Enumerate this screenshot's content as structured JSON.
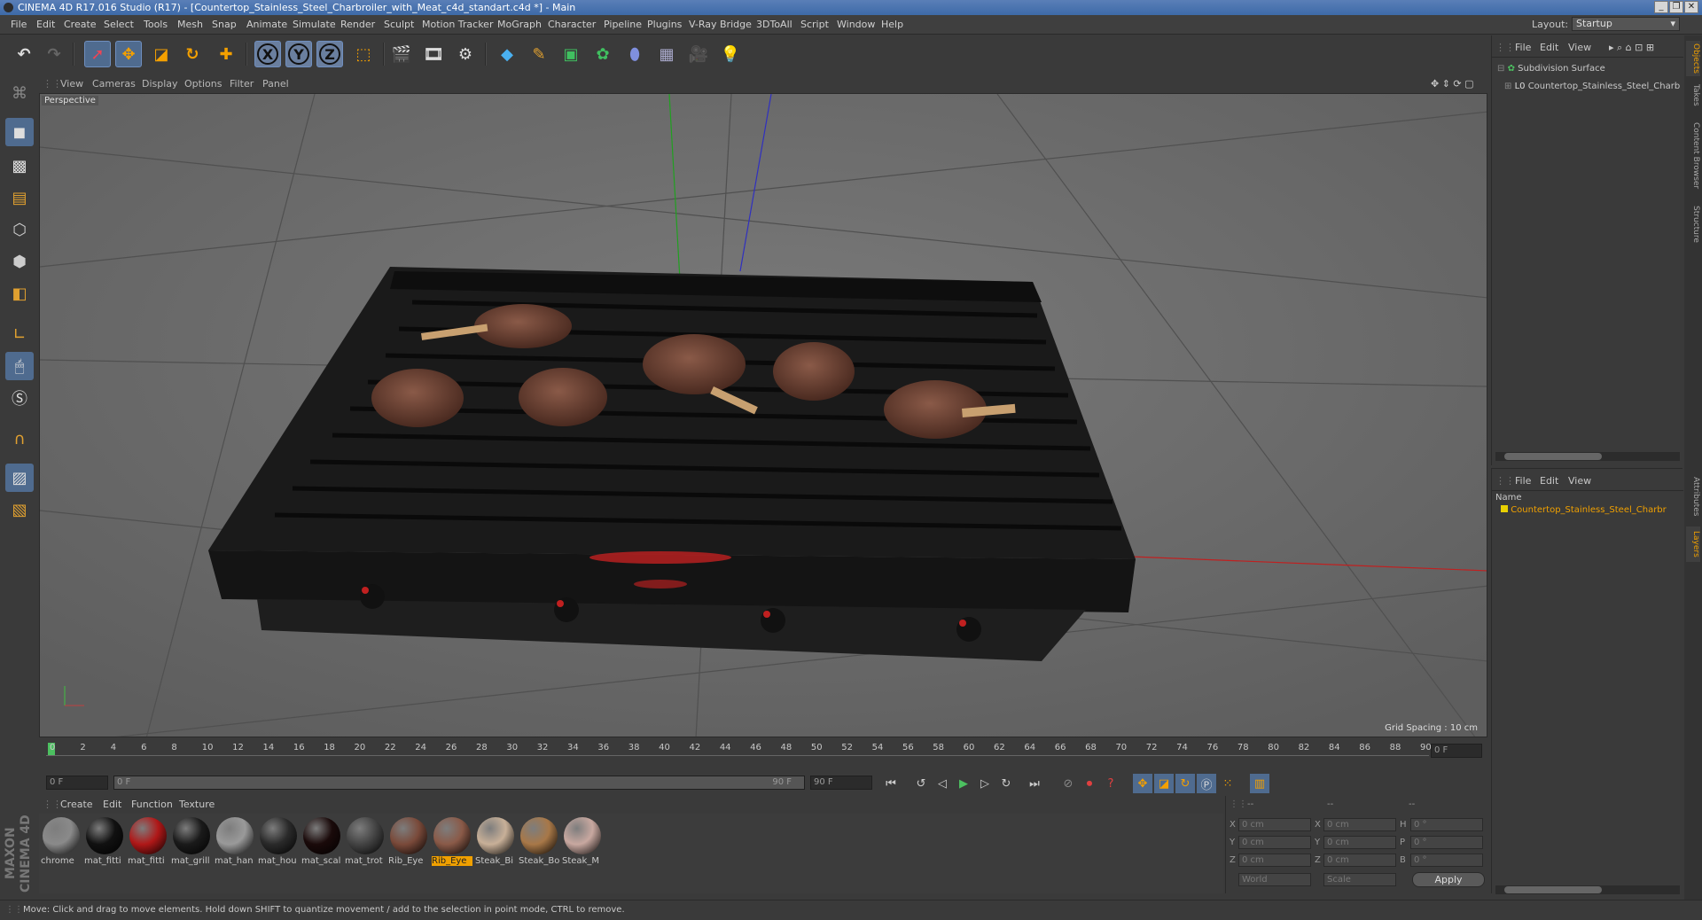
{
  "titlebar": {
    "title": "CINEMA 4D R17.016 Studio (R17) - [Countertop_Stainless_Steel_Charbroiler_with_Meat_c4d_standart.c4d *] - Main",
    "min": "_",
    "restore": "❐",
    "close": "✕"
  },
  "menubar": {
    "items": [
      "File",
      "Edit",
      "Create",
      "Select",
      "Tools",
      "Mesh",
      "Snap",
      "Animate",
      "Simulate",
      "Render",
      "Sculpt",
      "Motion Tracker",
      "MoGraph",
      "Character",
      "Pipeline",
      "Plugins",
      "V-Ray Bridge",
      "3DToAll",
      "Script",
      "Window",
      "Help"
    ],
    "layout_label": "Layout:",
    "layout_value": "Startup"
  },
  "toolbar": {
    "axis_x": "X",
    "axis_y": "Y",
    "axis_z": "Z"
  },
  "viewport": {
    "menu": [
      "View",
      "Cameras",
      "Display",
      "Options",
      "Filter",
      "Panel"
    ],
    "camera_label": "Perspective",
    "grid_spacing": "Grid Spacing : 10 cm"
  },
  "timeline": {
    "ticks": [
      "0",
      "2",
      "4",
      "6",
      "8",
      "10",
      "12",
      "14",
      "16",
      "18",
      "20",
      "22",
      "24",
      "26",
      "28",
      "30",
      "32",
      "34",
      "36",
      "38",
      "40",
      "42",
      "44",
      "46",
      "48",
      "50",
      "52",
      "54",
      "56",
      "58",
      "60",
      "62",
      "64",
      "66",
      "68",
      "70",
      "72",
      "74",
      "76",
      "78",
      "80",
      "82",
      "84",
      "86",
      "88",
      "90"
    ],
    "current_frame": "0 F"
  },
  "playbar": {
    "start": "0 F",
    "range_start": "0 F",
    "range_end": "90 F",
    "end": "90 F"
  },
  "materials": {
    "menu": [
      "Create",
      "Edit",
      "Function",
      "Texture"
    ],
    "items": [
      {
        "name": "chrome",
        "color": "#8a8a8a"
      },
      {
        "name": "mat_fitti",
        "color": "#111111"
      },
      {
        "name": "mat_fitti",
        "color": "#b01818"
      },
      {
        "name": "mat_grill",
        "color": "#1a1a1a"
      },
      {
        "name": "mat_han",
        "color": "#9a9a9a"
      },
      {
        "name": "mat_hou",
        "color": "#2a2a2a"
      },
      {
        "name": "mat_scal",
        "color": "#1a0a0a"
      },
      {
        "name": "mat_trot",
        "color": "#444444"
      },
      {
        "name": "Rib_Eye",
        "color": "#7a4a3a"
      },
      {
        "name": "Rib_Eye",
        "color": "#8a5a48"
      },
      {
        "name": "Steak_Bi",
        "color": "#c8b098"
      },
      {
        "name": "Steak_Bo",
        "color": "#a87848"
      },
      {
        "name": "Steak_M",
        "color": "#c8a8a0"
      }
    ],
    "selected_index": 9
  },
  "coords": {
    "header": "--",
    "rows": [
      {
        "a": "X",
        "av": "0 cm",
        "b": "X",
        "bv": "0 cm",
        "c": "H",
        "cv": "0 °"
      },
      {
        "a": "Y",
        "av": "0 cm",
        "b": "Y",
        "bv": "0 cm",
        "c": "P",
        "cv": "0 °"
      },
      {
        "a": "Z",
        "av": "0 cm",
        "b": "Z",
        "bv": "0 cm",
        "c": "B",
        "cv": "0 °"
      }
    ],
    "mode1": "World",
    "mode2": "Scale",
    "apply": "Apply"
  },
  "objects": {
    "menu": [
      "File",
      "Edit",
      "View"
    ],
    "tree": [
      "Subdivision Surface",
      "Countertop_Stainless_Steel_Charb"
    ]
  },
  "layers": {
    "menu": [
      "File",
      "Edit",
      "View"
    ],
    "col_name": "Name",
    "items": [
      "Countertop_Stainless_Steel_Charbr"
    ]
  },
  "sidetabs": [
    "Objects",
    "Takes",
    "Content Browser",
    "Structure",
    "Attributes",
    "Layers"
  ],
  "status": "Move: Click and drag to move elements. Hold down SHIFT to quantize movement / add to the selection in point mode, CTRL to remove.",
  "brand": "MAXON CINEMA 4D"
}
